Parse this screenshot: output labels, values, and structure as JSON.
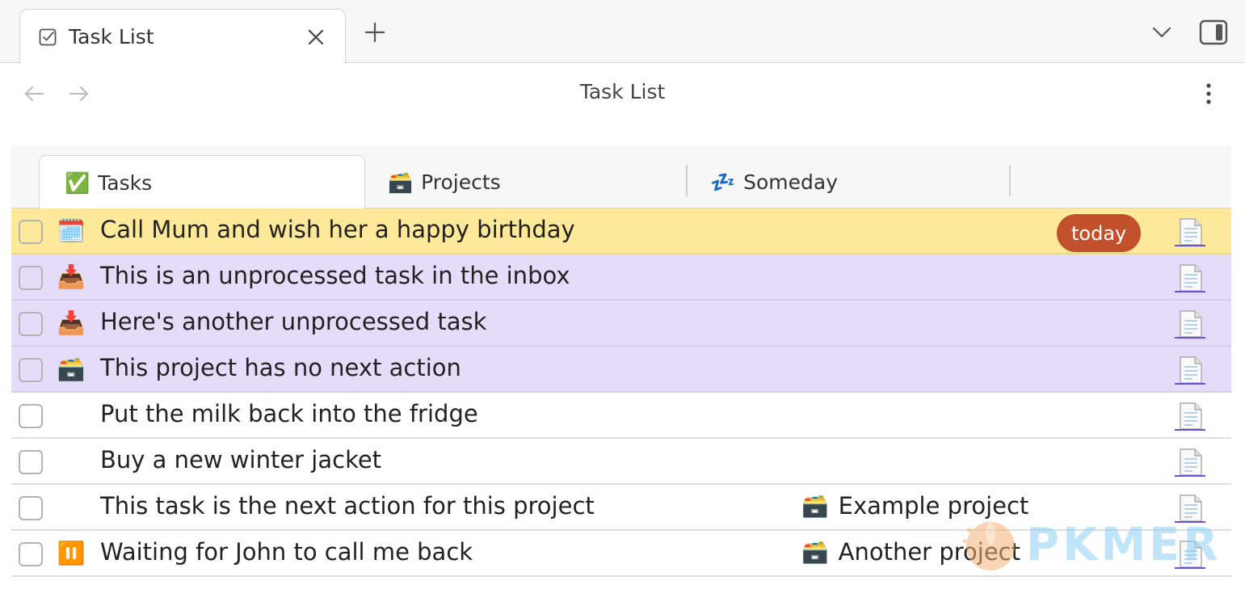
{
  "browser_tab": {
    "title": "Task List"
  },
  "header": {
    "title": "Task List"
  },
  "view_tabs": [
    {
      "emoji": "✅",
      "label": "Tasks",
      "active": true
    },
    {
      "emoji": "🗃️",
      "label": "Projects",
      "active": false
    },
    {
      "emoji": "💤",
      "label": "Someday",
      "active": false
    }
  ],
  "tasks": [
    {
      "icon": "🗓️",
      "text": "Call Mum and wish her a happy birthday",
      "badge": "today",
      "highlight": "yellow",
      "project": ""
    },
    {
      "icon": "📥",
      "text": "This is an unprocessed task in the inbox",
      "highlight": "purple",
      "project": ""
    },
    {
      "icon": "📥",
      "text": "Here's another unprocessed task",
      "highlight": "purple",
      "project": ""
    },
    {
      "icon": "🗃️",
      "text": "This project has no next action",
      "highlight": "purple",
      "project": ""
    },
    {
      "icon": "",
      "text": "Put the milk back into the fridge",
      "highlight": "none",
      "project": ""
    },
    {
      "icon": "",
      "text": "Buy a new winter jacket",
      "highlight": "none",
      "project": ""
    },
    {
      "icon": "",
      "text": "This task is the next action for this project",
      "highlight": "none",
      "project_emoji": "🗃️",
      "project": "Example project"
    },
    {
      "icon": "⏸️",
      "text": "Waiting for John to call me back",
      "highlight": "none",
      "project_emoji": "🗃️",
      "project": "Another project"
    }
  ],
  "watermark": {
    "text": "PKMER"
  },
  "colors": {
    "today_badge": "#c2502a",
    "highlight_yellow": "#fde999",
    "highlight_purple": "#e5dcfa"
  }
}
